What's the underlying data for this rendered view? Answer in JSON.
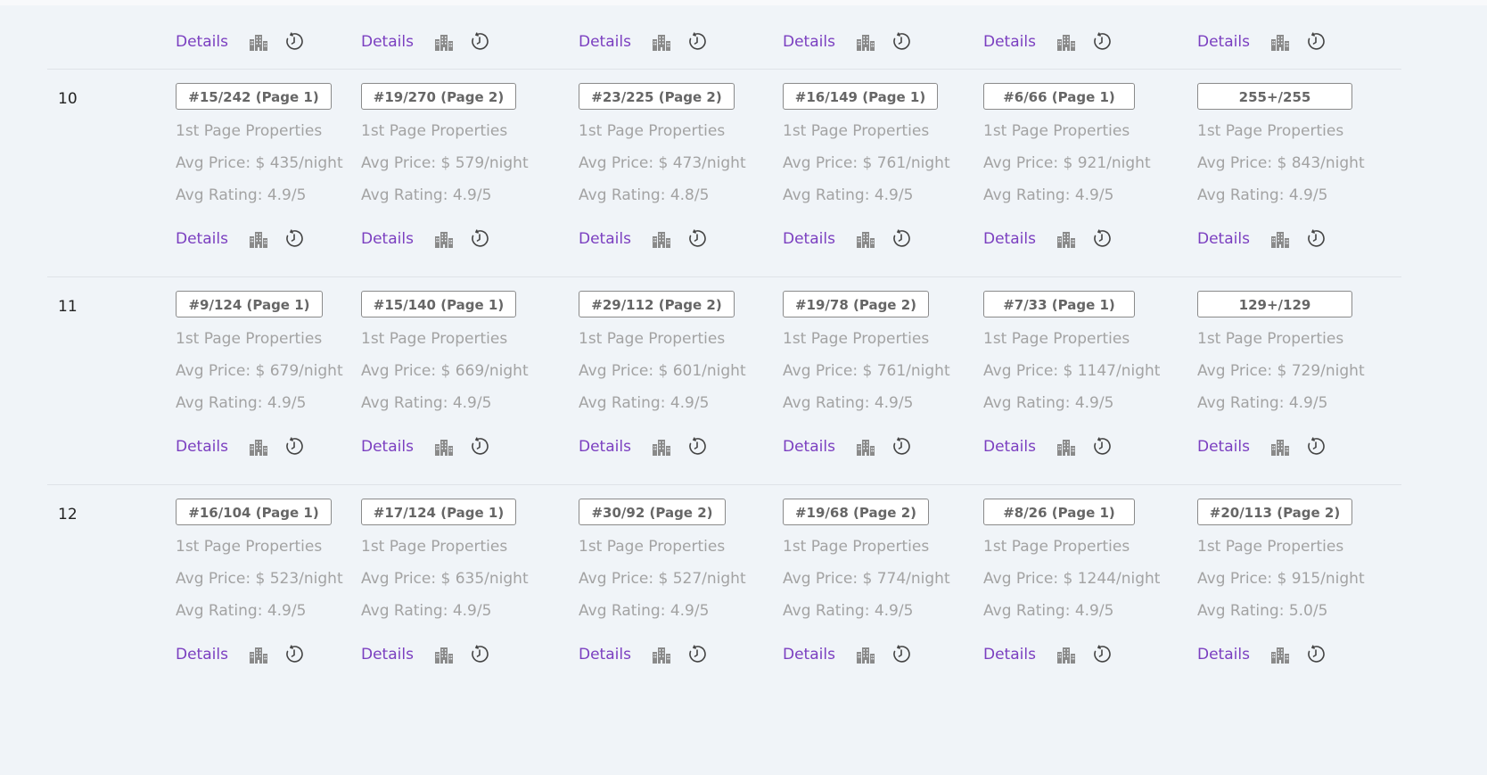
{
  "links": {
    "details": "Details"
  },
  "icons": {
    "building": "building-icon",
    "history": "history-clock-icon"
  },
  "colors": {
    "link": "#7b3fc0",
    "muted": "#a3a3a3",
    "background": "#f0f4f8"
  },
  "rows": [
    {
      "label": "10",
      "cells": [
        {
          "rank": "#15/242 (Page 1)",
          "props": "1st Page Properties",
          "price": "Avg Price: $ 435/night",
          "rating": "Avg Rating: 4.9/5"
        },
        {
          "rank": "#19/270 (Page 2)",
          "props": "1st Page Properties",
          "price": "Avg Price: $ 579/night",
          "rating": "Avg Rating: 4.9/5"
        },
        {
          "rank": "#23/225 (Page 2)",
          "props": "1st Page Properties",
          "price": "Avg Price: $ 473/night",
          "rating": "Avg Rating: 4.8/5"
        },
        {
          "rank": "#16/149 (Page 1)",
          "props": "1st Page Properties",
          "price": "Avg Price: $ 761/night",
          "rating": "Avg Rating: 4.9/5"
        },
        {
          "rank": "#6/66 (Page 1)",
          "props": "1st Page Properties",
          "price": "Avg Price: $ 921/night",
          "rating": "Avg Rating: 4.9/5"
        },
        {
          "rank": "255+/255",
          "props": "1st Page Properties",
          "price": "Avg Price: $ 843/night",
          "rating": "Avg Rating: 4.9/5"
        }
      ]
    },
    {
      "label": "11",
      "cells": [
        {
          "rank": "#9/124 (Page 1)",
          "props": "1st Page Properties",
          "price": "Avg Price: $ 679/night",
          "rating": "Avg Rating: 4.9/5"
        },
        {
          "rank": "#15/140 (Page 1)",
          "props": "1st Page Properties",
          "price": "Avg Price: $ 669/night",
          "rating": "Avg Rating: 4.9/5"
        },
        {
          "rank": "#29/112 (Page 2)",
          "props": "1st Page Properties",
          "price": "Avg Price: $ 601/night",
          "rating": "Avg Rating: 4.9/5"
        },
        {
          "rank": "#19/78 (Page 2)",
          "props": "1st Page Properties",
          "price": "Avg Price: $ 761/night",
          "rating": "Avg Rating: 4.9/5"
        },
        {
          "rank": "#7/33 (Page 1)",
          "props": "1st Page Properties",
          "price": "Avg Price: $ 1147/night",
          "rating": "Avg Rating: 4.9/5"
        },
        {
          "rank": "129+/129",
          "props": "1st Page Properties",
          "price": "Avg Price: $ 729/night",
          "rating": "Avg Rating: 4.9/5"
        }
      ]
    },
    {
      "label": "12",
      "cells": [
        {
          "rank": "#16/104 (Page 1)",
          "props": "1st Page Properties",
          "price": "Avg Price: $ 523/night",
          "rating": "Avg Rating: 4.9/5"
        },
        {
          "rank": "#17/124 (Page 1)",
          "props": "1st Page Properties",
          "price": "Avg Price: $ 635/night",
          "rating": "Avg Rating: 4.9/5"
        },
        {
          "rank": "#30/92 (Page 2)",
          "props": "1st Page Properties",
          "price": "Avg Price: $ 527/night",
          "rating": "Avg Rating: 4.9/5"
        },
        {
          "rank": "#19/68 (Page 2)",
          "props": "1st Page Properties",
          "price": "Avg Price: $ 774/night",
          "rating": "Avg Rating: 4.9/5"
        },
        {
          "rank": "#8/26 (Page 1)",
          "props": "1st Page Properties",
          "price": "Avg Price: $ 1244/night",
          "rating": "Avg Rating: 4.9/5"
        },
        {
          "rank": "#20/113 (Page 2)",
          "props": "1st Page Properties",
          "price": "Avg Price: $ 915/night",
          "rating": "Avg Rating: 5.0/5"
        }
      ]
    }
  ]
}
